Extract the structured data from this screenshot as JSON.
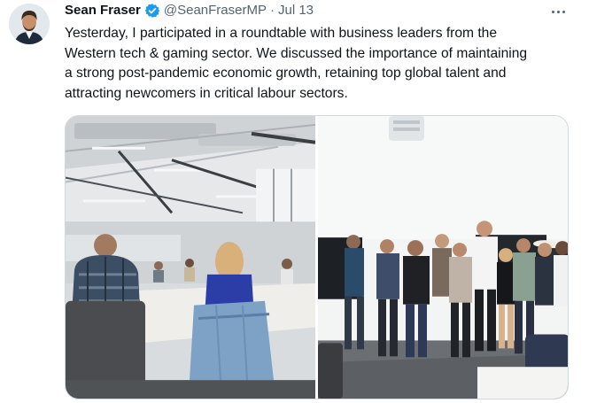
{
  "tweet": {
    "author_name": "Sean Fraser",
    "verified_icon": "verified-badge-icon",
    "handle": "@SeanFraserMP",
    "separator": "·",
    "timestamp": "Jul 13",
    "text_lines": [
      "Yesterday, I participated in a roundtable with business leaders from the",
      "Western tech & gaming sector. We discussed the importance of maintaining",
      "a strong post-pandemic economic growth, retaining top global talent and",
      "attracting newcomers in critical labour sectors."
    ],
    "more_icon": "more-options-icon",
    "media": [
      {
        "icon": "roundtable-meeting-photo"
      },
      {
        "icon": "group-photo"
      }
    ]
  },
  "colors": {
    "text_primary": "#0f1419",
    "text_secondary": "#536471",
    "verified_blue": "#1d9bf0",
    "border": "#cfd9de"
  }
}
